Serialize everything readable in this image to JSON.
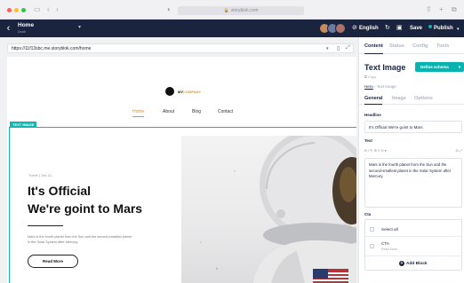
{
  "browser": {
    "url": "storyblok.com",
    "controls": [
      "‹",
      "›"
    ]
  },
  "header": {
    "title": "Home",
    "subtitle": "Draft",
    "language": "English",
    "save_label": "Save",
    "publish_label": "Publish"
  },
  "preview_url": "https://11f13sbc.me.storyblok.com/home",
  "site": {
    "logo_text_a": "MY",
    "logo_text_b": "COMPANY",
    "nav": [
      "Home",
      "About",
      "Blog",
      "Contact"
    ],
    "block_tag": "TEXT IMAGE",
    "meta": "Travel | Jan 21",
    "headline_line1": "It's Official",
    "headline_line2": "We're goint to Mars",
    "body": "Mars is the fourth planet from the Sun and the second-smallest planet in the Solar System after Mercury.",
    "read_more": "Read More"
  },
  "panel": {
    "tabs": [
      "Content",
      "Status",
      "Config",
      "Tools"
    ],
    "title": "Text Image",
    "schema_button": "Define schema",
    "copy": "Copy",
    "breadcrumb_link": "Hero",
    "breadcrumb_current": "Text Image",
    "subtabs": [
      "General",
      "Image",
      "Options"
    ],
    "headline_label": "Headline",
    "headline_value": "It's Official We're goint to Mars",
    "text_label": "Text",
    "toolbar": "B  I  ✎  ☰  ≡  H  ▾",
    "text_value": "Mars is the fourth planet from the Sun and the second-smallest planet in the Solar System after Mercury.",
    "cta_label": "Cta",
    "select_all": "Select all",
    "cta_item": "CTA",
    "cta_item_sub": "Read More",
    "add_block": "Add Block"
  },
  "colors": {
    "header_bg": "#1b243f",
    "accent": "#09b3af",
    "nav_active": "#e38c3b"
  }
}
